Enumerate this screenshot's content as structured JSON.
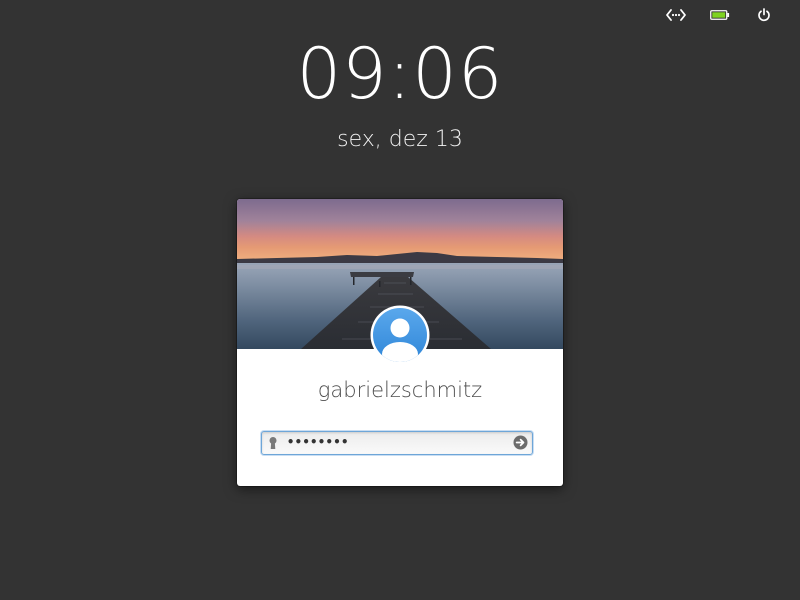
{
  "indicators": [
    {
      "name": "network",
      "icon": "network-wired-icon"
    },
    {
      "name": "battery",
      "icon": "battery-full-icon",
      "color": "#7ed321"
    },
    {
      "name": "power",
      "icon": "power-icon"
    }
  ],
  "clock": {
    "time": "09:06",
    "date": "sex, dez 13"
  },
  "login": {
    "username": "gabrielzschmitz",
    "password_mask": "••••••••",
    "avatar_icon": "user-avatar-icon",
    "accent_color": "#3b8fde",
    "submit_icon": "arrow-right-circle-icon"
  }
}
